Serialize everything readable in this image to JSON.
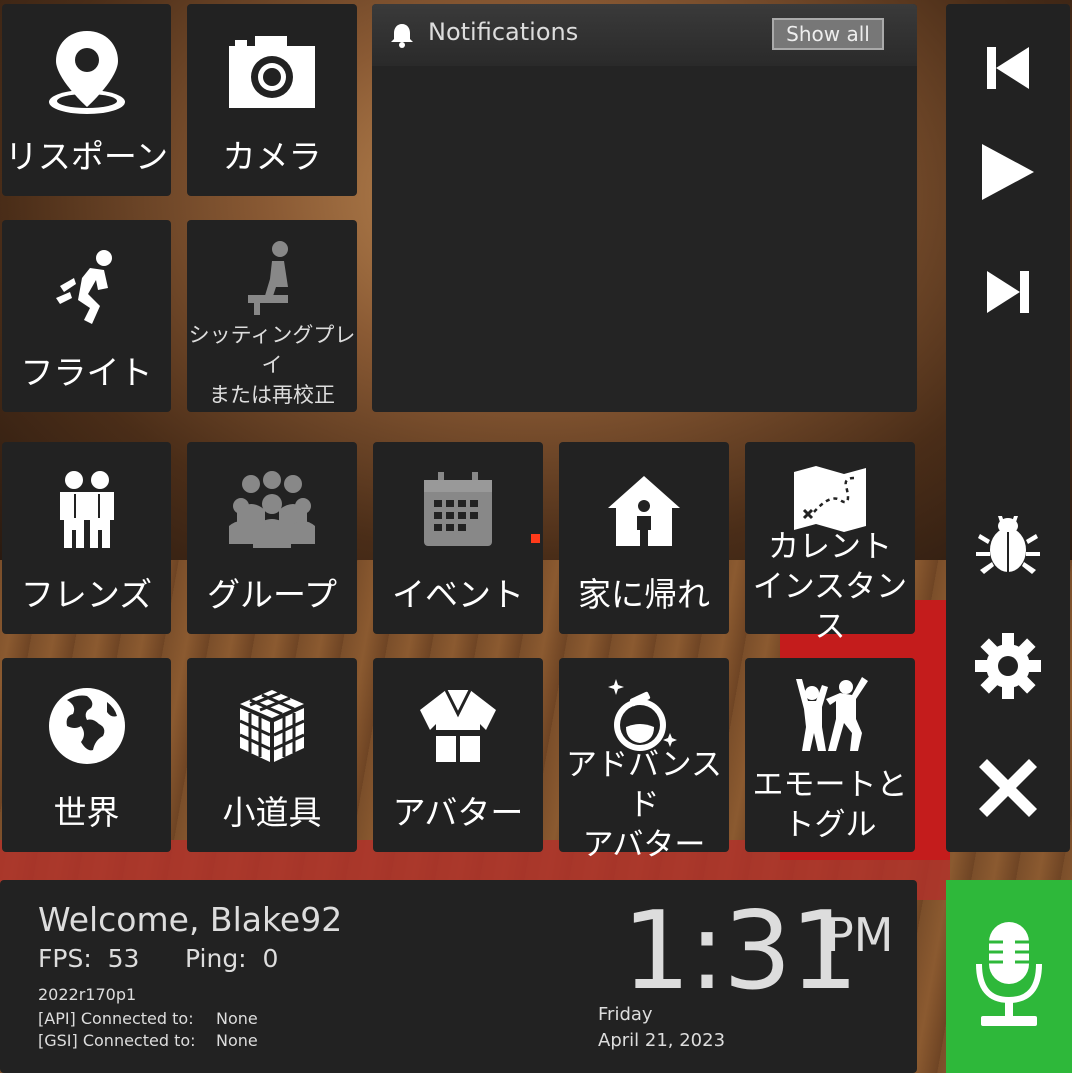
{
  "tiles": {
    "respawn": "リスポーン",
    "camera": "カメラ",
    "flight": "フライト",
    "seated": "シッティングプレイ\nまたは再校正",
    "friends": "フレンズ",
    "groups": "グループ",
    "events": "イベント",
    "go_home": "家に帰れ",
    "current_instance": "カレント\nインスタンス",
    "worlds": "世界",
    "props": "小道具",
    "avatar": "アバター",
    "advanced_avatar": "アドバンスド\nアバター",
    "emote_toggle": "エモートと\nトグル"
  },
  "notifications": {
    "title": "Notifications",
    "show_all": "Show all"
  },
  "sidebar": {
    "icons": [
      "skip-previous-icon",
      "play-icon",
      "skip-next-icon",
      "bug-icon",
      "gear-icon",
      "close-icon"
    ]
  },
  "status": {
    "welcome": "Welcome, Blake92",
    "fps_label": "FPS:",
    "fps_value": "53",
    "ping_label": "Ping:",
    "ping_value": "0",
    "build": "2022r170p1",
    "api_label": "[API] Connected to:",
    "api_value": "None",
    "gsi_label": "[GSI] Connected to:",
    "gsi_value": "None",
    "time": "1:31",
    "ampm": "PM",
    "day": "Friday",
    "date": "April 21, 2023"
  },
  "colors": {
    "tile_bg": "#222222",
    "mic_green": "#2eb83a",
    "event_dot": "#ff3a1a"
  }
}
